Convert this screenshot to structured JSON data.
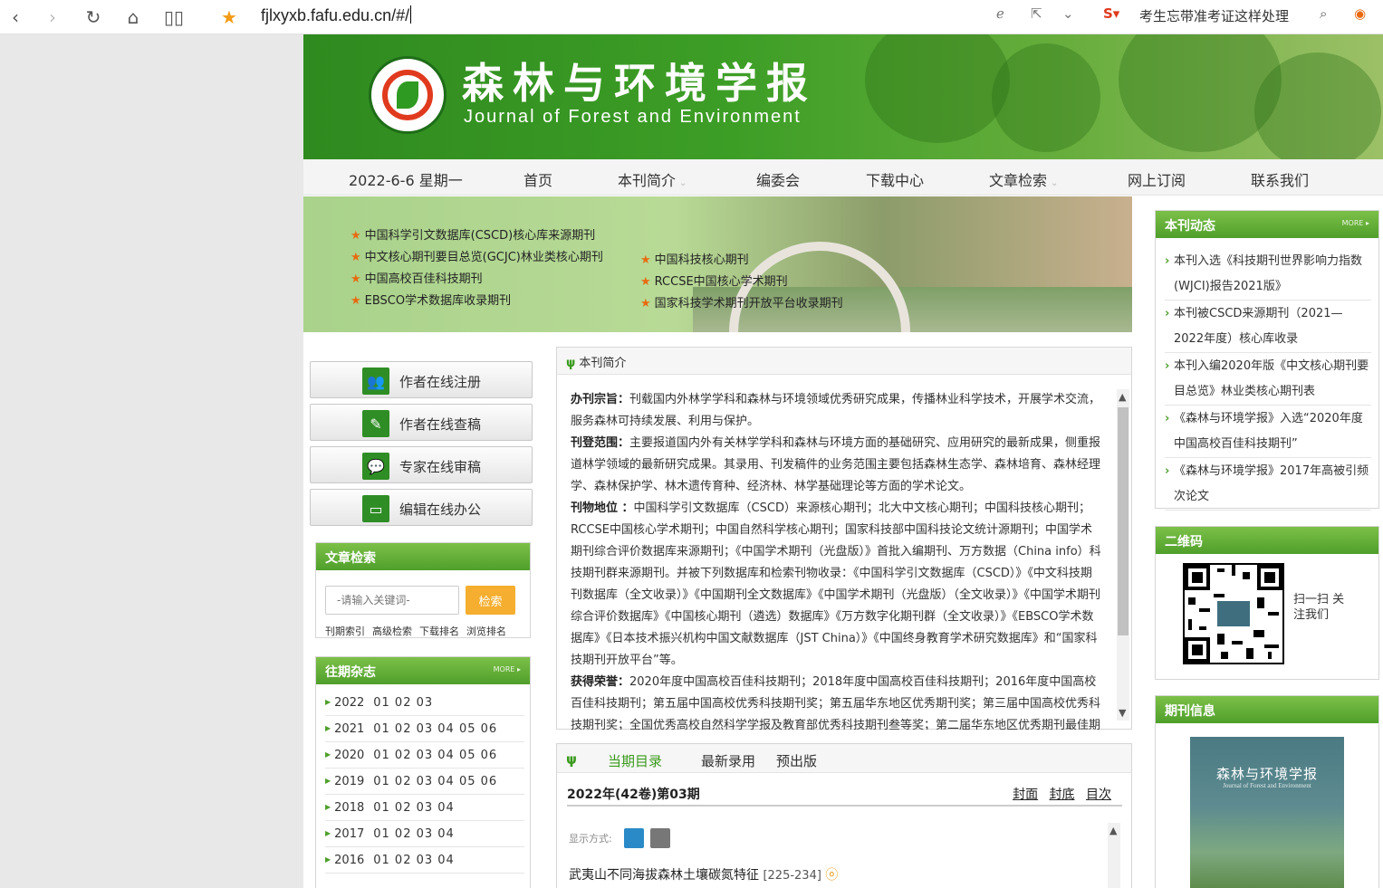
{
  "browser": {
    "url": "fjlxyxb.fafu.edu.cn/#/",
    "search_hint": "考生忘带准考证这样处理"
  },
  "site": {
    "title_cn": "森林与环境学报",
    "title_en": "Journal of Forest and Environment",
    "nav": {
      "date": "2022-6-6 星期一",
      "items": [
        "首页",
        "本刊简介",
        "编委会",
        "下载中心",
        "文章检索",
        "网上订阅",
        "联系我们"
      ]
    },
    "hero": {
      "left": [
        "中国科学引文数据库(CSCD)核心库来源期刊",
        "中文核心期刊要目总览(GCJC)林业类核心期刊",
        "中国高校百佳科技期刊",
        "EBSCO学术数据库收录期刊"
      ],
      "right": [
        "中国科技核心期刊",
        "RCCSE中国核心学术期刊",
        "国家科技学术期刊开放平台收录期刊"
      ]
    },
    "left_buttons": [
      "作者在线注册",
      "作者在线查稿",
      "专家在线审稿",
      "编辑在线办公"
    ],
    "search": {
      "title": "文章检索",
      "placeholder": "-请输入关键词-",
      "button": "检索",
      "links": [
        "刊期索引",
        "高级检索",
        "下载排名",
        "浏览排名"
      ]
    },
    "archive": {
      "title": "往期杂志",
      "more": "MORE ▸",
      "years": [
        {
          "year": "2022",
          "issues": "01 02 03"
        },
        {
          "year": "2021",
          "issues": "01 02 03 04 05 06"
        },
        {
          "year": "2020",
          "issues": "01 02 03 04 05 06"
        },
        {
          "year": "2019",
          "issues": "01 02 03 04 05 06"
        },
        {
          "year": "2018",
          "issues": "01 02 03 04"
        },
        {
          "year": "2017",
          "issues": "01 02 03 04"
        },
        {
          "year": "2016",
          "issues": "01 02 03 04"
        }
      ]
    },
    "intro": {
      "title": "本刊简介",
      "p1_label": "办刊宗旨：",
      "p1": "刊载国内外林学学科和森林与环境领域优秀研究成果，传播林业科学技术，开展学术交流，服务森林可持续发展、利用与保护。",
      "p2_label": "刊登范围：",
      "p2": "主要报道国内外有关林学学科和森林与环境方面的基础研究、应用研究的最新成果，侧重报道林学领域的最新研究成果。其录用、刊发稿件的业务范围主要包括森林生态学、森林培育、森林经理学、森林保护学、林木遗传育种、经济林、林学基础理论等方面的学术论文。",
      "p3_label": "刊物地位 ：",
      "p3": "中国科学引文数据库（CSCD）来源核心期刊；北大中文核心期刊；中国科技核心期刊；RCCSE中国核心学术期刊；中国自然科学核心期刊；国家科技部中国科技论文统计源期刊；中国学术期刊综合评价数据库来源期刊；《中国学术期刊（光盘版）》首批入编期刊、万方数据（China info）科技期刊群来源期刊。并被下列数据库和检索刊物收录：《中国科学引文数据库（CSCD）》《中文科技期刊数据库（全文收录）》《中国期刊全文数据库》《中国学术期刊（光盘版）（全文收录）》《中国学术期刊综合评价数据库》《中国核心期刊（遴选）数据库》《万方数字化期刊群（全文收录）》《EBSCO学术数据库》《日本技术振兴机构中国文献数据库（JST China）》《中国终身教育学术研究数据库》和“国家科技期刊开放平台”等。",
      "p4_label": "获得荣誉：",
      "p4": "2020年度中国高校百佳科技期刊；2018年度中国高校百佳科技期刊；2016年度中国高校百佳科技期刊；第五届中国高校优秀科技期刊奖；第五届华东地区优秀期刊奖；第三届中国高校优秀科技期刊奖；全国优秀高校自然科学学报及教育部优秀科技期刊叁等奖；第二届华东地区优秀期刊最佳期刊"
    },
    "current": {
      "tabs": [
        "当期目录",
        "最新录用",
        "预出版"
      ],
      "issue": "2022年(42卷)第03期",
      "links": [
        "封面",
        "封底",
        "目次"
      ],
      "display_label": "显示方式:",
      "article": "武夷山不同海拔森林土壤碳氮特征",
      "pages": "[225-234]"
    },
    "news": {
      "title": "本刊动态",
      "more": "MORE ▸",
      "items": [
        "本刊入选《科技期刊世界影响力指数(WJCI)报告2021版》",
        "本刊被CSCD来源期刊（2021—2022年度）核心库收录",
        "本刊入编2020年版《中文核心期刊要目总览》林业类核心期刊表",
        "《森林与环境学报》入选“2020年度中国高校百佳科技期刊”",
        "《森林与环境学报》2017年高被引频次论文"
      ]
    },
    "qrcode": {
      "title": "二维码",
      "text": "扫一扫 关注我们"
    },
    "journal_info": {
      "title": "期刊信息",
      "cover_title": "森林与环境学报",
      "cover_en": "Journal of Forest and Environment"
    }
  }
}
